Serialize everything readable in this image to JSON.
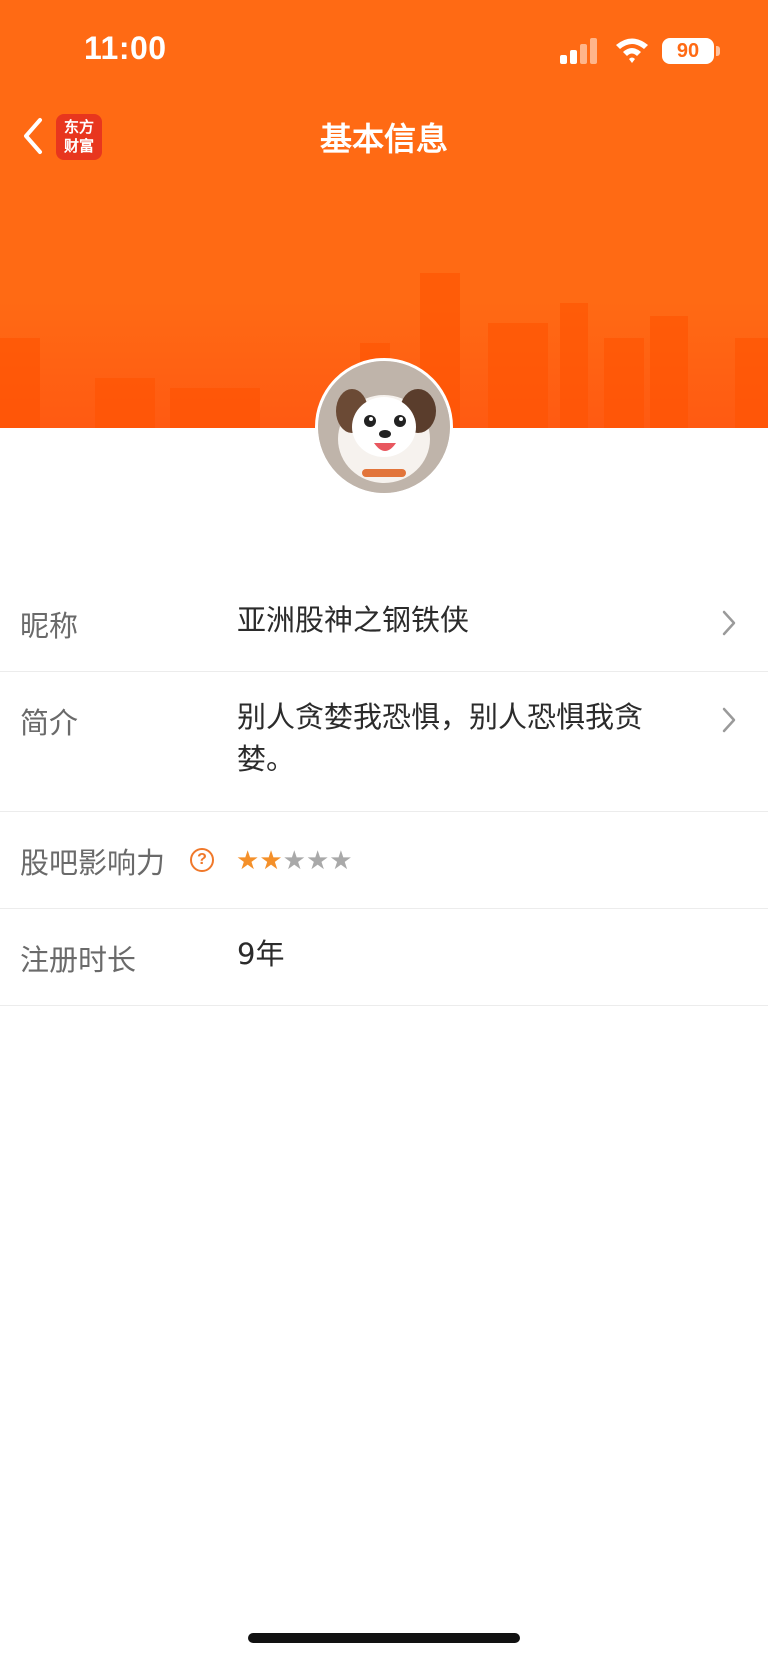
{
  "status_bar": {
    "time": "11:00",
    "battery": "90"
  },
  "nav": {
    "title": "基本信息",
    "logo_line1": "东方",
    "logo_line2": "财富"
  },
  "profile": {
    "rows": [
      {
        "label": "昵称",
        "value": "亚洲股神之钢铁侠"
      },
      {
        "label": "简介",
        "value": "别人贪婪我恐惧，别人恐惧我贪婪。"
      },
      {
        "label": "股吧影响力",
        "value": ""
      },
      {
        "label": "注册时长",
        "value": "9年"
      }
    ],
    "influence_stars": {
      "filled": 2,
      "total": 5
    }
  },
  "colors": {
    "brand": "#ff6a14",
    "star_on": "#f4902a",
    "star_off": "#a9a9a9"
  },
  "icons": [
    "back-arrow-icon",
    "help-icon",
    "chevron-right-icon",
    "signal-icon",
    "wifi-icon",
    "battery-icon"
  ]
}
